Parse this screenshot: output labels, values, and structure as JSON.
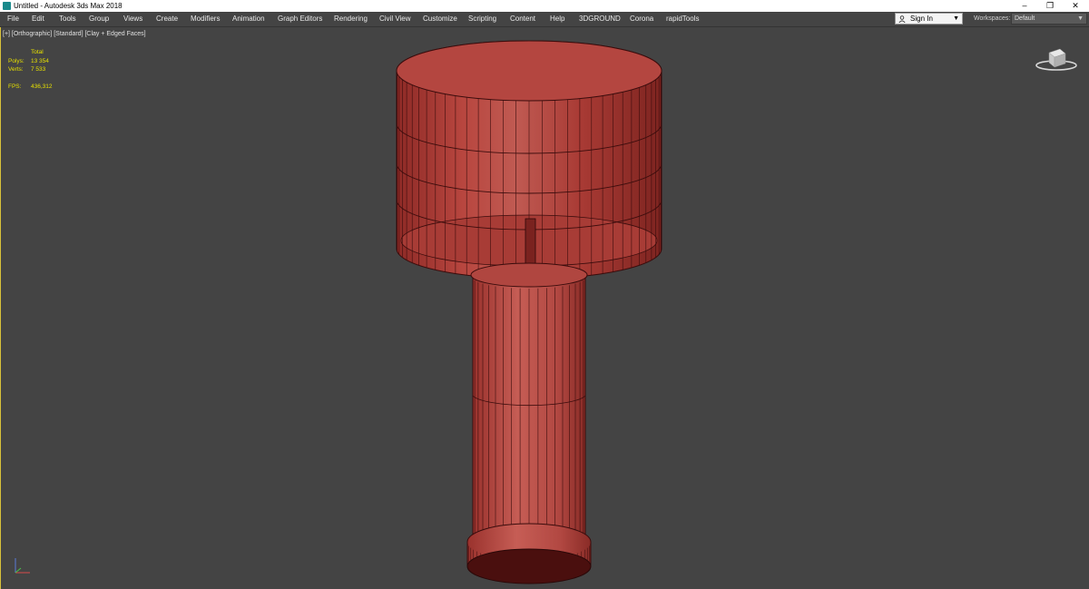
{
  "window": {
    "title": "Untitled - Autodesk 3ds Max 2018",
    "controls": [
      "–",
      "❐",
      "✕"
    ]
  },
  "menu": [
    "File",
    "Edit",
    "Tools",
    "Group",
    "Views",
    "Create",
    "Modifiers",
    "Animation",
    "Graph Editors",
    "Rendering",
    "Civil View",
    "Customize",
    "Scripting",
    "Content",
    "Help",
    "3DGROUND",
    "Corona",
    "rapidTools"
  ],
  "signin": {
    "label": "Sign In"
  },
  "workspaces": {
    "label": "Workspaces:",
    "value": "Default"
  },
  "viewport": {
    "label": "[+] [Orthographic] [Standard] [Clay + Edged Faces]",
    "stats": {
      "header": "Total",
      "polys_label": "Polys:",
      "polys": "13 354",
      "verts_label": "Verts:",
      "verts": "7 533",
      "fps_label": "FPS:",
      "fps": "436,312"
    }
  },
  "colors": {
    "model_face": "#b84842",
    "model_edge": "#3a0c0c",
    "stats_text": "#e6e000",
    "viewport_bg": "#444444"
  }
}
